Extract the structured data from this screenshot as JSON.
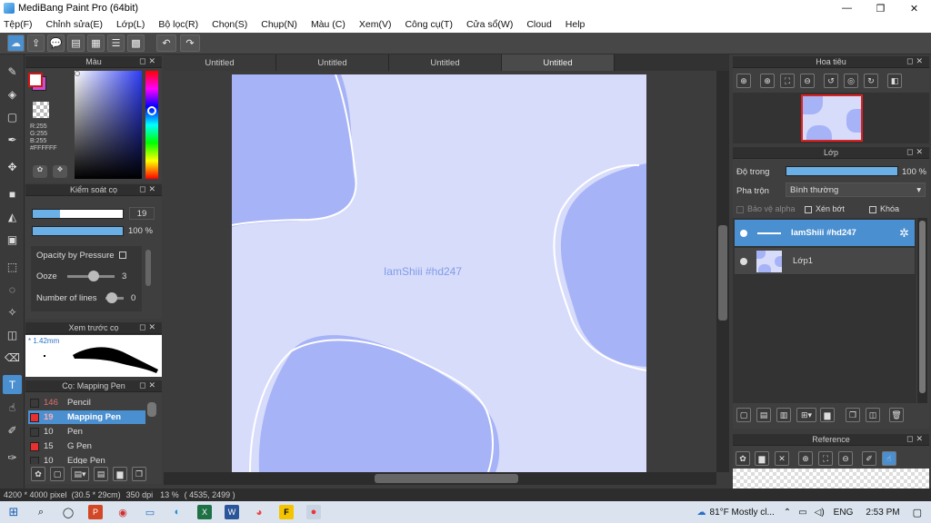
{
  "window": {
    "title": "MediBang Paint Pro (64bit)",
    "minimize": "—",
    "maximize": "❐",
    "close": "✕"
  },
  "menu": [
    "Tệp(F)",
    "Chỉnh sửa(E)",
    "Lớp(L)",
    "Bộ lọc(R)",
    "Chọn(S)",
    "Chụp(N)",
    "Màu (C)",
    "Xem(V)",
    "Công cụ(T)",
    "Cửa sổ(W)",
    "Cloud",
    "Help"
  ],
  "toolbar": {
    "cloud": "☁",
    "upload": "⇪",
    "chat": "💬",
    "comment": "▤",
    "page": "▦",
    "list": "☰",
    "grid": "▩",
    "undo": "↶",
    "redo": "↷"
  },
  "tools": [
    "✎",
    "◈",
    "▢",
    "✒",
    "✥",
    "■",
    "◭",
    "▣",
    "⬚",
    "◌",
    "✧",
    "◫",
    "⌫",
    "T",
    "☝",
    "✐",
    "✑"
  ],
  "color_panel": {
    "title": "Màu",
    "r": "R:255",
    "g": "G:255",
    "b": "B:255",
    "hex": "#FFFFFF"
  },
  "brush_control": {
    "title": "Kiểm soát cọ",
    "size": "19",
    "opacity": "100 %",
    "opacity_by_pressure": "Opacity by Pressure",
    "ooze_label": "Ooze",
    "ooze_value": "3",
    "lines_label": "Number of lines",
    "lines_value": "0",
    "size_fill": 0.3,
    "opacity_fill": 1.0,
    "ooze_level": 0.55,
    "lines_level": 0.05
  },
  "brush_preview": {
    "title": "Xem trước cọ",
    "size": "1.42mm"
  },
  "brush_list": {
    "title": "Cọ: Mapping Pen",
    "items": [
      {
        "size": "146",
        "name": "Pencil",
        "color": "#3a3a3a",
        "selected": false
      },
      {
        "size": "19",
        "name": "Mapping Pen",
        "color": "#e83030",
        "selected": true
      },
      {
        "size": "10",
        "name": "Pen",
        "color": "#3a3a3a",
        "selected": false
      },
      {
        "size": "15",
        "name": "G Pen",
        "color": "#e83030",
        "selected": false
      },
      {
        "size": "10",
        "name": "Edge Pen",
        "color": "#3a3a3a",
        "selected": false
      }
    ]
  },
  "tabs": [
    "Untitled",
    "Untitled",
    "Untitled",
    "Untitled"
  ],
  "canvas": {
    "watermark": "IamShiii #hd247"
  },
  "navigator": {
    "title": "Hoa tiêu"
  },
  "layers": {
    "title": "Lớp",
    "opacity_label": "Độ trong",
    "opacity_value": "100 %",
    "opacity_fill": 1.0,
    "blend_label": "Pha trộn",
    "blend_value": "Bình thường",
    "protect_alpha": "Bảo vệ alpha",
    "clipping": "Xén bớt",
    "lock": "Khóa",
    "items": [
      {
        "name": "IamShiii #hd247",
        "selected": true
      },
      {
        "name": "Lớp1",
        "selected": false
      }
    ]
  },
  "reference": {
    "title": "Reference"
  },
  "status": {
    "size": "4200 * 4000 pixel",
    "dims": "(30.5 * 29cm)",
    "dpi": "350 dpi",
    "zoom": "13 %",
    "coords": "( 4535, 2499 )"
  },
  "taskbar": {
    "weather": "81°F  Mostly cl...",
    "lang": "ENG",
    "time": "2:53 PM"
  },
  "colors": {
    "accent": "#4a8fd0",
    "canvas": "#d8dcfb",
    "blob": "#a6b3f6"
  }
}
